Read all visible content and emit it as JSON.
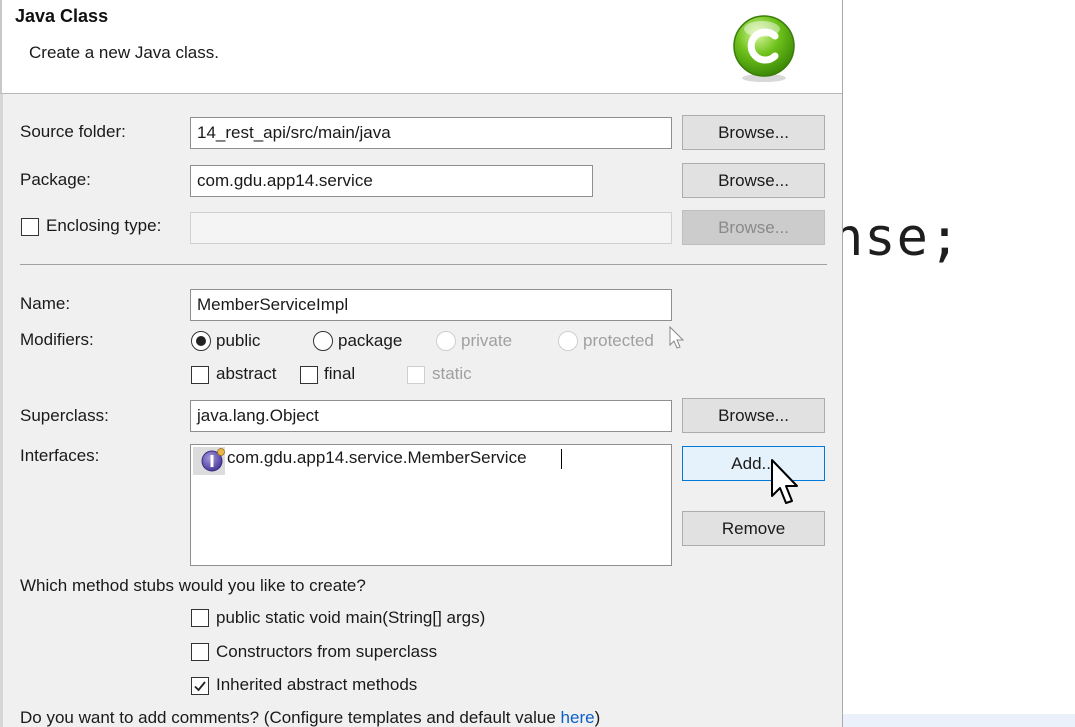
{
  "editor": {
    "code_fragment": "nse;"
  },
  "dialog": {
    "title": "Java Class",
    "description": "Create a new Java class."
  },
  "form": {
    "source_folder": {
      "label": "Source folder:",
      "value": "14_rest_api/src/main/java",
      "browse_label": "Browse..."
    },
    "package": {
      "label": "Package:",
      "value": "com.gdu.app14.service",
      "browse_label": "Browse..."
    },
    "enclosing_type": {
      "label": "Enclosing type:",
      "checked": false,
      "value": "",
      "browse_label": "Browse..."
    },
    "name": {
      "label": "Name:",
      "value": "MemberServiceImpl"
    },
    "modifiers": {
      "label": "Modifiers:",
      "access": [
        "public",
        "package",
        "private",
        "protected"
      ],
      "selected": "public",
      "public": "public",
      "package": "package",
      "private": "private",
      "protected": "protected",
      "abstract": "abstract",
      "final": "final",
      "static": "static"
    },
    "superclass": {
      "label": "Superclass:",
      "value": "java.lang.Object",
      "browse_label": "Browse..."
    },
    "interfaces": {
      "label": "Interfaces:",
      "items": [
        "com.gdu.app14.service.MemberService"
      ],
      "add_label": "Add...",
      "remove_label": "Remove"
    },
    "method_stubs": {
      "question": "Which method stubs would you like to create?",
      "main": {
        "label": "public static void main(String[] args)",
        "checked": false
      },
      "constructors": {
        "label": "Constructors from superclass",
        "checked": false
      },
      "inherited": {
        "label": "Inherited abstract methods",
        "checked": true
      }
    },
    "comments": {
      "question": "Do you want to add comments? (Configure templates and default value ",
      "link": "here",
      "suffix": ")"
    }
  }
}
